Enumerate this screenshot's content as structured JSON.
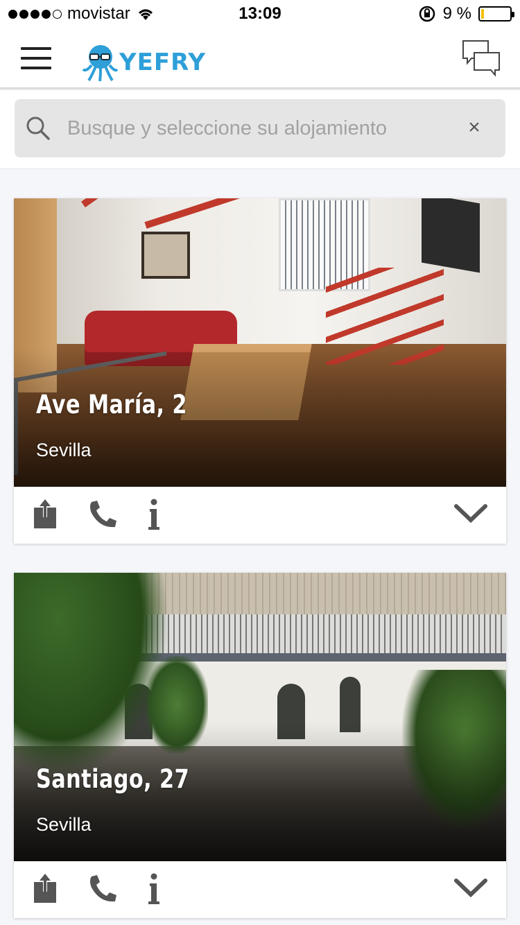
{
  "status_bar": {
    "carrier": "movistar",
    "time": "13:09",
    "battery_percent": "9 %",
    "battery_level": 0.09,
    "signal_bars": 4
  },
  "header": {
    "logo_text": "YEFRY",
    "brand_color": "#2e9fd8"
  },
  "search": {
    "placeholder": "Busque y seleccione su alojamiento",
    "value": "",
    "clear_label": "×"
  },
  "listings": [
    {
      "title": "Ave María, 2",
      "city": "Sevilla"
    },
    {
      "title": "Santiago, 27",
      "city": "Sevilla"
    }
  ],
  "icons": {
    "menu": "hamburger-menu-icon",
    "chat": "chat-bubbles-icon",
    "search": "search-icon",
    "share": "share-icon",
    "phone": "phone-icon",
    "info": "info-icon",
    "expand": "chevron-down-icon"
  }
}
